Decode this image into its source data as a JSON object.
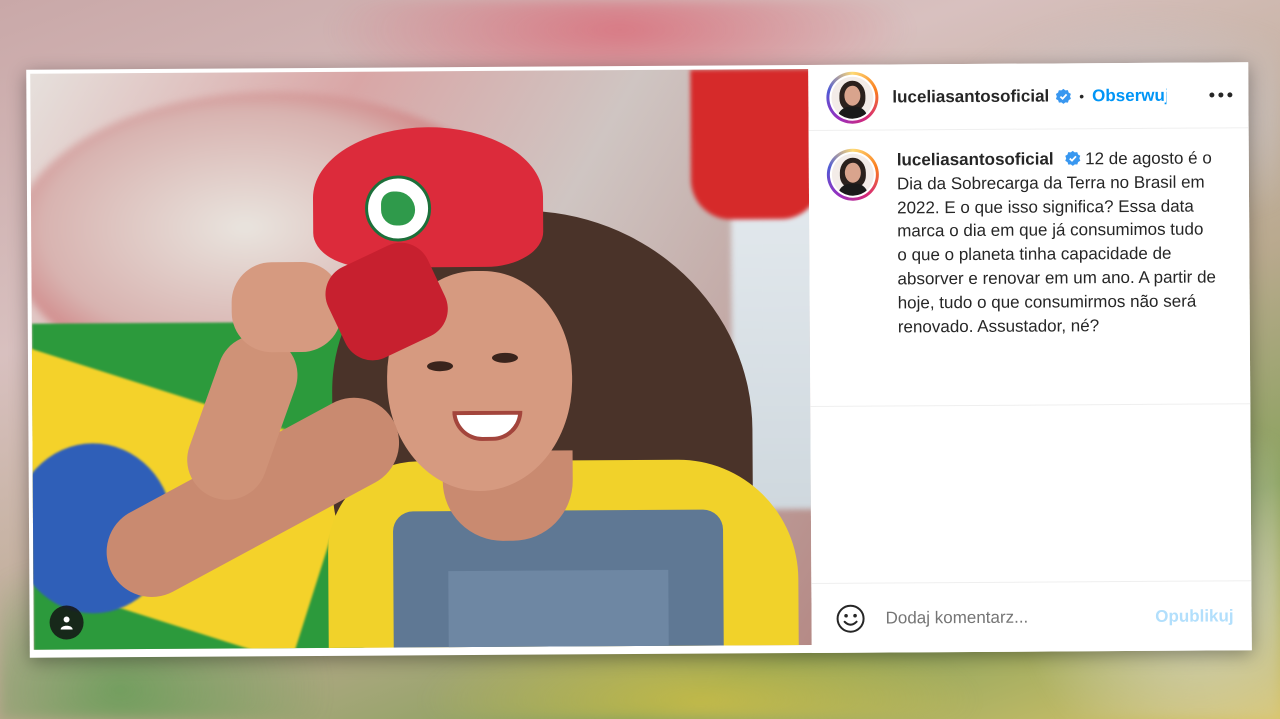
{
  "post": {
    "username": "luceliasantosoficial",
    "separator": "•",
    "follow_label": "Obserwuj",
    "caption": "12 de agosto é o Dia da Sobrecarga da Terra no Brasil em 2022. E o que isso significa? Essa data marca o dia em que já consumimos tudo o que o planeta tinha capacidade de absorver e renovar em um ano. A partir de hoje, tudo o que consumirmos não será renovado. Assustador, né?"
  },
  "comment": {
    "placeholder": "Dodaj komentarz...",
    "publish_label": "Opublikuj"
  },
  "icons": {
    "verified": "verified-badge-icon",
    "more": "more-options-icon",
    "emoji": "emoji-icon",
    "user_tag": "user-tag-icon"
  },
  "colors": {
    "accent": "#0095f6",
    "publish_disabled": "#b2dffc",
    "text": "#262626"
  }
}
